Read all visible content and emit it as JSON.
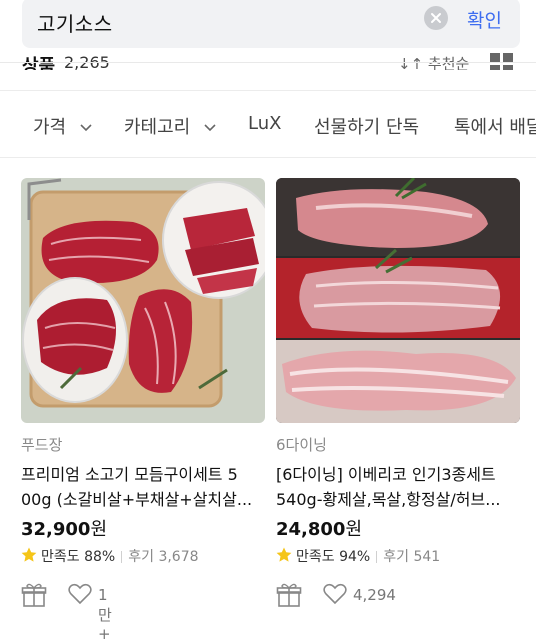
{
  "search": {
    "query": "고기소스",
    "confirm_label": "확인"
  },
  "summary": {
    "label": "상품",
    "count": "2,265",
    "sort_label": "↓↑ 추천순"
  },
  "filters": [
    {
      "label": "가격",
      "has_dropdown": true
    },
    {
      "label": "카테고리",
      "has_dropdown": true
    },
    {
      "label": "LuX",
      "has_dropdown": false
    },
    {
      "label": "선물하기 단독",
      "has_dropdown": false
    },
    {
      "label": "톡에서 배달",
      "has_dropdown": false
    }
  ],
  "products": [
    {
      "seller": "푸드장",
      "title_line1": "프리미엄 소고기 모듬구이세트 5",
      "title_line2": "00g (소갈비살+부채살+살치살...",
      "price": "32,900",
      "currency": "원",
      "satisfaction_label": "만족도",
      "satisfaction": "88%",
      "review_label": "후기",
      "reviews": "3,678",
      "likes": "1만+"
    },
    {
      "seller": "6다이닝",
      "title_line1": "[6다이닝] 이베리코 인기3종세트",
      "title_line2": "540g-황제살,목살,항정살/허브...",
      "price": "24,800",
      "currency": "원",
      "satisfaction_label": "만족도",
      "satisfaction": "94%",
      "review_label": "후기",
      "reviews": "541",
      "likes": "4,294"
    }
  ],
  "colors": {
    "accent": "#3e6df0",
    "star": "#f5c518"
  }
}
